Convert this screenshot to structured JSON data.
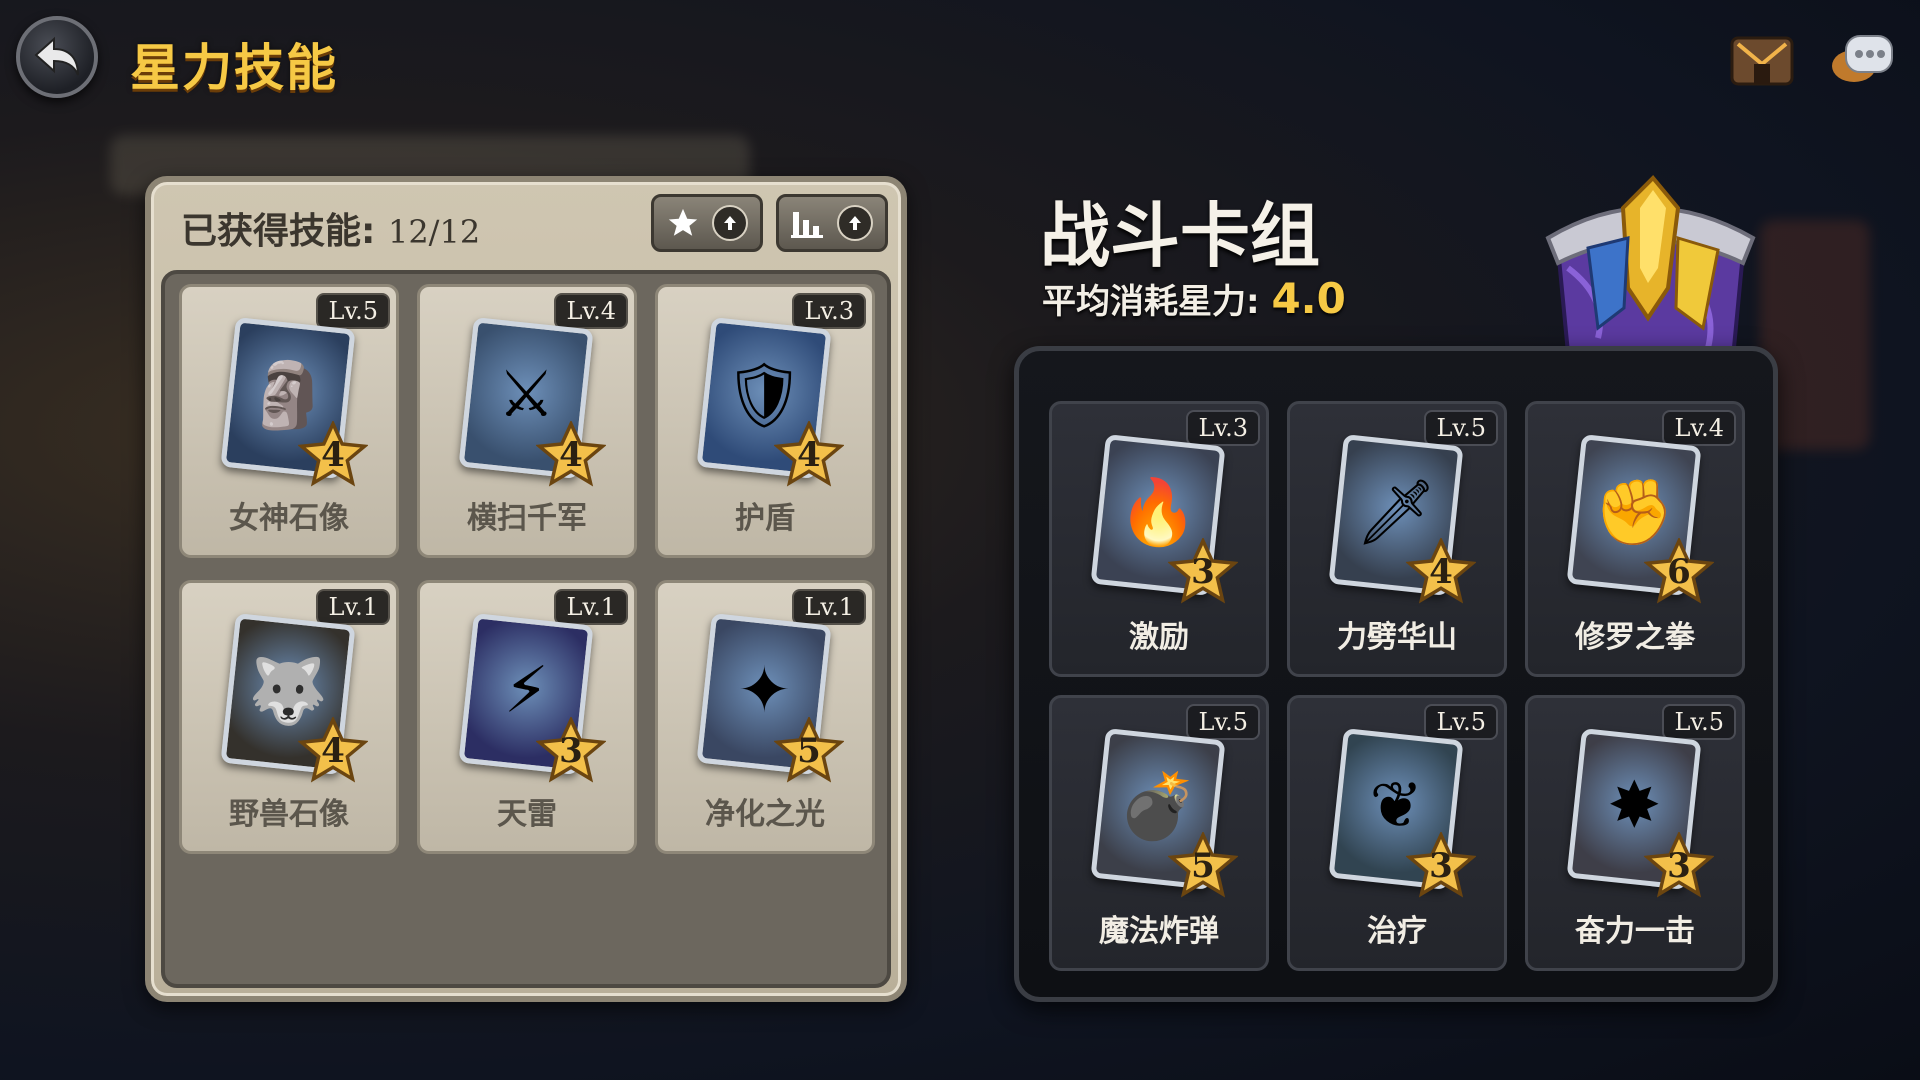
{
  "header": {
    "title": "星力技能"
  },
  "owned": {
    "label": "已获得技能:",
    "count": "12/12",
    "cards": [
      {
        "name": "女神石像",
        "level": "Lv.5",
        "cost": "4",
        "icon": "goddess-statue-icon",
        "color": "#2b3f5e"
      },
      {
        "name": "横扫千军",
        "level": "Lv.4",
        "cost": "4",
        "icon": "sweep-sword-icon",
        "color": "#39506e"
      },
      {
        "name": "护盾",
        "level": "Lv.3",
        "cost": "4",
        "icon": "shield-crystal-icon",
        "color": "#2f4b78"
      },
      {
        "name": "野兽石像",
        "level": "Lv.1",
        "cost": "4",
        "icon": "beast-statue-icon",
        "color": "#34312c"
      },
      {
        "name": "天雷",
        "level": "Lv.1",
        "cost": "3",
        "icon": "thunder-icon",
        "color": "#2c2e63"
      },
      {
        "name": "净化之光",
        "level": "Lv.1",
        "cost": "5",
        "icon": "purify-light-icon",
        "color": "#3a4762"
      }
    ]
  },
  "deck": {
    "title": "战斗卡组",
    "avg_label": "平均消耗星力:",
    "avg_value": "4.0",
    "cards": [
      {
        "name": "激励",
        "level": "Lv.3",
        "cost": "3",
        "icon": "inspire-flame-icon",
        "color": "#3b4253"
      },
      {
        "name": "力劈华山",
        "level": "Lv.5",
        "cost": "4",
        "icon": "power-slash-icon",
        "color": "#36404f"
      },
      {
        "name": "修罗之拳",
        "level": "Lv.4",
        "cost": "6",
        "icon": "asura-fist-icon",
        "color": "#3f4452"
      },
      {
        "name": "魔法炸弹",
        "level": "Lv.5",
        "cost": "5",
        "icon": "magic-bomb-icon",
        "color": "#3c3f49"
      },
      {
        "name": "治疗",
        "level": "Lv.5",
        "cost": "3",
        "icon": "heal-icon",
        "color": "#314451"
      },
      {
        "name": "奋力一击",
        "level": "Lv.5",
        "cost": "3",
        "icon": "fierce-strike-icon",
        "color": "#3e3e48"
      }
    ]
  },
  "colors": {
    "accent_gold": "#f6c945",
    "panel_beige": "#cfc6b1",
    "deck_dark": "#15171c"
  }
}
